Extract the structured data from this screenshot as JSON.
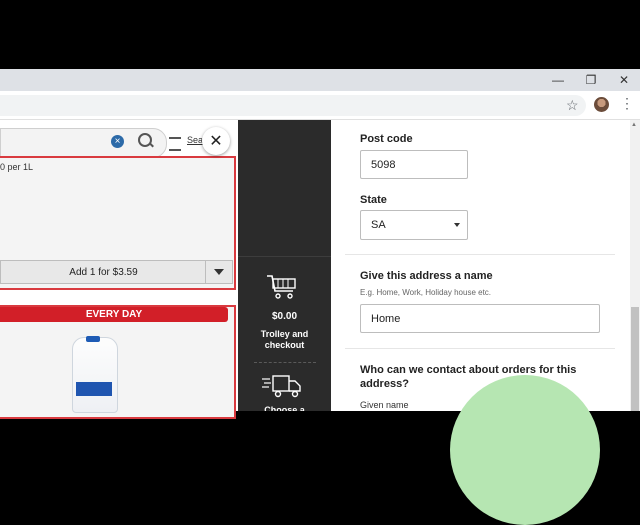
{
  "browser": {
    "minimize_glyph": "—",
    "restore_glyph": "❐",
    "close_glyph": "✕",
    "star_glyph": "☆",
    "menu_glyph": "⋮"
  },
  "shop": {
    "filter_label": "Sea",
    "price_per_unit": "0 per 1L",
    "add_button_label": "Add 1 for $3.59",
    "badge_label": "EVERY DAY"
  },
  "modal": {
    "close_glyph": "✕"
  },
  "sidebar": {
    "trolley_amount": "$0.00",
    "trolley_label_line1": "Trolley and",
    "trolley_label_line2": "checkout",
    "delivery_label": "Choose a"
  },
  "form": {
    "postcode_label": "Post code",
    "postcode_value": "5098",
    "state_label": "State",
    "state_value": "SA",
    "address_name_label": "Give this address a name",
    "address_name_hint": "E.g.  Home, Work, Holiday house etc.",
    "address_name_value": "Home",
    "contact_question_line1": "Who can we contact about orders for this",
    "contact_question_line2": "address?",
    "given_name_label": "Given name"
  },
  "colors": {
    "brand_red": "#d21f28",
    "side_panel": "#2b2b2b",
    "accent_green": "#b6e6b2"
  }
}
